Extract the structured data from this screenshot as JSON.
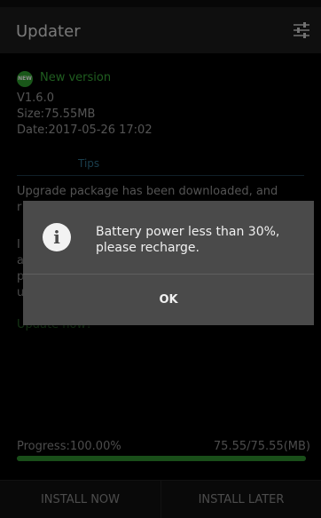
{
  "app_bar": {
    "title": "Updater",
    "settings_icon": "sliders-icon"
  },
  "update": {
    "new_badge": "NEW",
    "new_label": "New version",
    "version": "V1.6.0",
    "size": "Size:75.55MB",
    "date": "Date:2017-05-26 17:02"
  },
  "tips": {
    "label": "Tips",
    "line1": "Upgrade package has been downloaded, and",
    "line2": "r",
    "line3": "I",
    "line4": "a",
    "line5": "p",
    "line6": "u",
    "update_now": "Update now?"
  },
  "progress": {
    "label": "Progress:100.00%",
    "value": "75.55/75.55(MB)",
    "fraction": 1.0
  },
  "bottom": {
    "install_now": "INSTALL NOW",
    "install_later": "INSTALL LATER"
  },
  "dialog": {
    "icon": "info-icon",
    "message": "Battery power less than 30%, please recharge.",
    "ok": "OK"
  },
  "colors": {
    "accent_green": "#2f9e2f",
    "dialog_bg": "#4a4a4a",
    "background": "#000000"
  }
}
